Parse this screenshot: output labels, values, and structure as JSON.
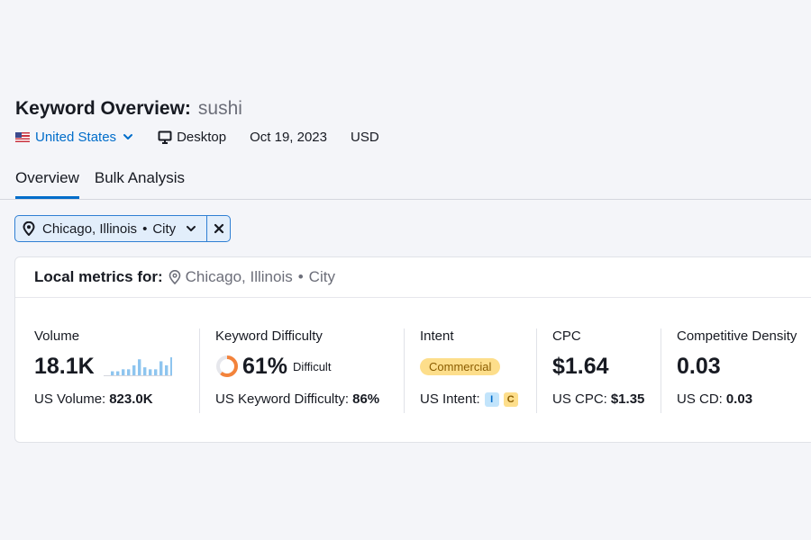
{
  "header": {
    "title_label": "Keyword Overview:",
    "keyword": "sushi",
    "database": "United States",
    "device": "Desktop",
    "date": "Oct 19, 2023",
    "currency": "USD"
  },
  "tabs": [
    {
      "label": "Overview",
      "active": true
    },
    {
      "label": "Bulk Analysis",
      "active": false
    }
  ],
  "filter_chip": {
    "location": "Chicago, Illinois",
    "dot": "•",
    "type": "City"
  },
  "local_metrics": {
    "header_label": "Local metrics for:",
    "location": "Chicago, Illinois",
    "dot": "•",
    "type": "City"
  },
  "metrics": {
    "volume": {
      "label": "Volume",
      "value": "18.1K",
      "sub_label": "US Volume:",
      "sub_value": "823.0K",
      "trend": [
        2,
        2,
        3,
        3,
        5,
        8,
        4,
        3,
        3,
        7,
        5,
        9
      ]
    },
    "difficulty": {
      "label": "Keyword Difficulty",
      "value": "61%",
      "level": "Difficult",
      "percent": 61,
      "sub_label": "US Keyword Difficulty:",
      "sub_value": "86%"
    },
    "intent": {
      "label": "Intent",
      "value": "Commercial",
      "sub_label": "US Intent:",
      "badges": [
        "I",
        "C"
      ]
    },
    "cpc": {
      "label": "CPC",
      "value": "$1.64",
      "sub_label": "US CPC:",
      "sub_value": "$1.35"
    },
    "density": {
      "label": "Competitive Density",
      "value": "0.03",
      "sub_label": "US CD:",
      "sub_value": "0.03"
    }
  },
  "colors": {
    "accent": "#006dca",
    "difficulty_ring": "#f3833b",
    "intent_commercial": "#fdde8b",
    "sparkline": "#8ec5ef"
  }
}
